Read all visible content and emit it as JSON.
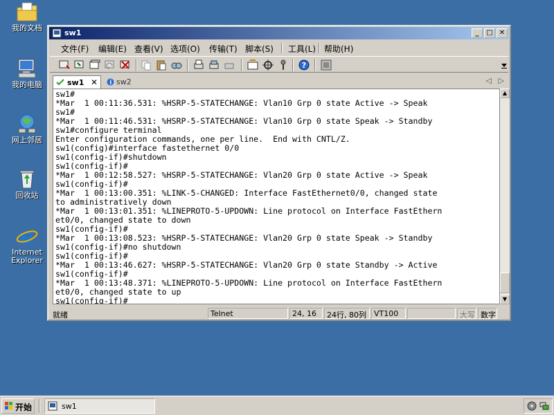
{
  "desktop": {
    "icons": [
      {
        "label": "我的文档",
        "icon": "folder-document-icon"
      },
      {
        "label": "我的电脑",
        "icon": "computer-icon"
      },
      {
        "label": "网上邻居",
        "icon": "network-icon"
      },
      {
        "label": "回收站",
        "icon": "recycle-bin-icon"
      },
      {
        "label": "Internet\nExplorer",
        "icon": "ie-icon"
      }
    ]
  },
  "window": {
    "title": "sw1",
    "controls": {
      "minimize": "_",
      "maximize": "□",
      "close": "✕"
    }
  },
  "menu": [
    "文件(F)",
    "编辑(E)",
    "查看(V)",
    "选项(O)",
    "传输(T)",
    "脚本(S)",
    "工具(L)",
    "帮助(H)"
  ],
  "tabs": [
    {
      "label": "sw1",
      "active": true,
      "status": "connected"
    },
    {
      "label": "sw2",
      "active": false,
      "status": "info"
    }
  ],
  "tab_close": "✕",
  "tab_nav": {
    "left": "◁",
    "right": "▷"
  },
  "terminal": {
    "lines": [
      "sw1#",
      "*Mar  1 00:11:36.531: %HSRP-5-STATECHANGE: Vlan10 Grp 0 state Active -> Speak",
      "sw1#",
      "*Mar  1 00:11:46.531: %HSRP-5-STATECHANGE: Vlan10 Grp 0 state Speak -> Standby",
      "sw1#configure terminal",
      "Enter configuration commands, one per line.  End with CNTL/Z.",
      "sw1(config)#interface fastethernet 0/0",
      "sw1(config-if)#shutdown",
      "sw1(config-if)#",
      "*Mar  1 00:12:58.527: %HSRP-5-STATECHANGE: Vlan20 Grp 0 state Active -> Speak",
      "sw1(config-if)#",
      "*Mar  1 00:13:00.351: %LINK-5-CHANGED: Interface FastEthernet0/0, changed state",
      "to administratively down",
      "*Mar  1 00:13:01.351: %LINEPROTO-5-UPDOWN: Line protocol on Interface FastEthern",
      "et0/0, changed state to down",
      "sw1(config-if)#",
      "*Mar  1 00:13:08.523: %HSRP-5-STATECHANGE: Vlan20 Grp 0 state Speak -> Standby",
      "sw1(config-if)#no shutdown",
      "sw1(config-if)#",
      "*Mar  1 00:13:46.627: %HSRP-5-STATECHANGE: Vlan20 Grp 0 state Standby -> Active",
      "sw1(config-if)#",
      "*Mar  1 00:13:48.371: %LINEPROTO-5-UPDOWN: Line protocol on Interface FastEthern",
      "et0/0, changed state to up",
      "sw1(config-if)#"
    ],
    "scroll_up": "▲",
    "scroll_down": "▼"
  },
  "status": {
    "ready": "就绪",
    "protocol": "Telnet",
    "cursor": "24, 16",
    "size": "24行, 80列",
    "emulation": "VT100",
    "empty": "",
    "caps": "大写",
    "num": "数字"
  },
  "taskbar": {
    "start": "开始",
    "task": "sw1"
  },
  "colors": {
    "desktop": "#3a6ea5",
    "title_active": "#0a246a",
    "face": "#d4d0c8"
  }
}
